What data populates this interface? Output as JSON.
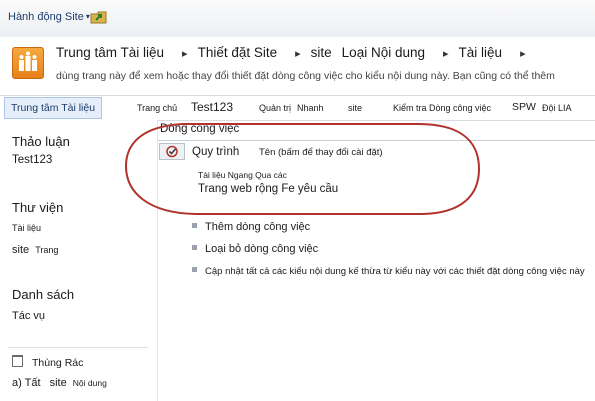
{
  "topbar": {
    "site_actions_label": "Hành động Site",
    "site_actions_caret": "▾"
  },
  "header": {
    "breadcrumb": [
      "Trung tâm Tài liệu",
      "Thiết đặt Site",
      "site",
      "Loại Nội dung",
      "Tài liệu"
    ],
    "breadcrumb_separator": "▸",
    "description": "dùng trang này để xem hoặc thay đổi thiết đặt dòng công việc cho kiểu nội dung này. Bạn cũng có thể thêm"
  },
  "topnav": {
    "selected_tab": "Trung tâm Tài liệu",
    "items": [
      "Trang chủ",
      "Test123",
      "Quản trị",
      "Nhanh",
      "site",
      "Kiểm tra Dòng công việc",
      "SPW",
      "Đội LIA"
    ]
  },
  "quicklaunch": {
    "discussions_heading": "Thảo luận",
    "discussions_item": "Test123",
    "libraries_heading": "Thư viện",
    "libraries_item": "Tài liệu",
    "libraries_item2_a": "site",
    "libraries_item2_b": "Trang",
    "lists_heading": "Danh sách",
    "lists_item": "Tác vụ",
    "recycle_bin": "Thùng Rác",
    "all_site_content_a": "a) Tất",
    "all_site_content_b": "site",
    "all_site_content_c": "Nội dung"
  },
  "main": {
    "workflow_section_title": "Dòng công việc",
    "column_process": "Quy trình",
    "column_name": "Tên (bấm để thay đổi cài đặt)",
    "workflow_row_sub": "Tài liệu Ngang Qua các",
    "workflow_row_link": "Trang web rộng Fe yêu cầu",
    "actions": [
      "Thêm dòng công việc",
      "Loại bỏ dòng công việc",
      "Cập nhật tất cả các kiểu nội dung kế thừa từ kiểu này với các thiết đặt dòng công việc này"
    ]
  },
  "colors": {
    "accent": "#1b3d6b",
    "selected_tab_bg": "#e5eef9",
    "annotation_oval": "#b1322c",
    "logo_orange": "#e8801a"
  },
  "icons": {
    "nav_up": "folder-up-icon",
    "logo": "site-logo-icon",
    "workflow": "workflow-check-icon",
    "recycle": "recycle-bin-icon",
    "bullet": "bullet-icon"
  }
}
